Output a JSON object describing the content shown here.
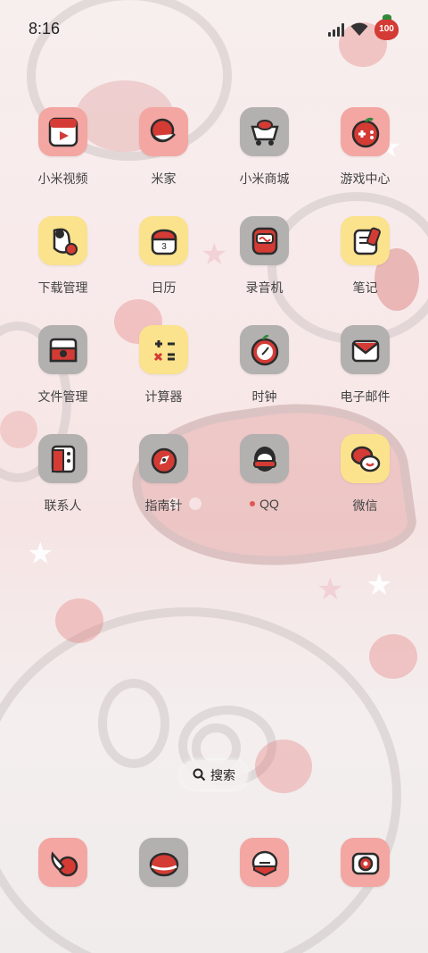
{
  "status": {
    "time": "8:16",
    "battery": "100"
  },
  "apps": [
    {
      "label": "小米视频",
      "icon": "video-play-icon",
      "bg": "pink"
    },
    {
      "label": "米家",
      "icon": "mijia-hand-icon",
      "bg": "pink"
    },
    {
      "label": "小米商城",
      "icon": "shopping-cart-icon",
      "bg": "gray"
    },
    {
      "label": "游戏中心",
      "icon": "gamepad-icon",
      "bg": "pink"
    },
    {
      "label": "下载管理",
      "icon": "download-character-icon",
      "bg": "yellow"
    },
    {
      "label": "日历",
      "icon": "calendar-icon",
      "bg": "yellow"
    },
    {
      "label": "录音机",
      "icon": "recorder-icon",
      "bg": "gray"
    },
    {
      "label": "笔记",
      "icon": "notes-icon",
      "bg": "yellow"
    },
    {
      "label": "文件管理",
      "icon": "folder-icon",
      "bg": "gray"
    },
    {
      "label": "计算器",
      "icon": "calculator-icon",
      "bg": "yellow"
    },
    {
      "label": "时钟",
      "icon": "clock-icon",
      "bg": "gray"
    },
    {
      "label": "电子邮件",
      "icon": "mail-icon",
      "bg": "gray"
    },
    {
      "label": "联系人",
      "icon": "contacts-icon",
      "bg": "gray"
    },
    {
      "label": "指南针",
      "icon": "compass-icon",
      "bg": "gray"
    },
    {
      "label": "QQ",
      "icon": "qq-icon",
      "bg": "gray",
      "new": true
    },
    {
      "label": "微信",
      "icon": "wechat-icon",
      "bg": "yellow"
    }
  ],
  "calendar_day": "3",
  "search": {
    "label": "搜索"
  },
  "dock": [
    {
      "icon": "phone-icon",
      "bg": "pink"
    },
    {
      "icon": "messages-icon",
      "bg": "gray"
    },
    {
      "icon": "chat-bubble-icon",
      "bg": "pink"
    },
    {
      "icon": "camera-icon",
      "bg": "pink"
    }
  ],
  "colors": {
    "accent_red": "#d43b35",
    "icon_pink": "#f3a6a2",
    "icon_yellow": "#fbe28c",
    "icon_gray": "#b3b0b0"
  }
}
